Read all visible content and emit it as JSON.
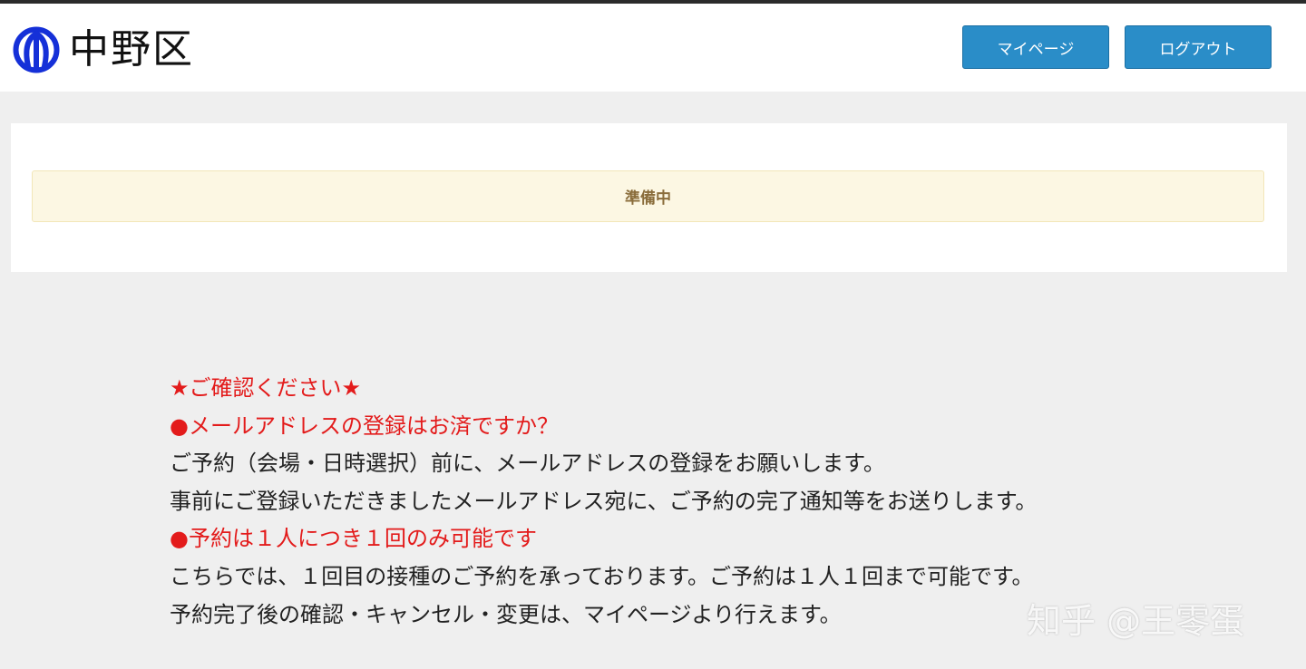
{
  "header": {
    "logo_text": "中野区",
    "buttons": {
      "mypage": "マイページ",
      "logout": "ログアウト"
    }
  },
  "panel": {
    "notice_text": "準備中"
  },
  "info": {
    "lines": [
      "★ご確認ください★",
      "●メールアドレスの登録はお済ですか？",
      "ご予約（会場・日時選択）前に、メールアドレスの登録をお願いします。",
      "事前にご登録いただきましたメールアドレス宛に、ご予約の完了通知等をお送りします。",
      "●予約は１人につき１回のみ可能です",
      "こちらでは、１回目の接種のご予約を承っております。ご予約は１人１回まで可能です。",
      "予約完了後の確認・キャンセル・変更は、マイページより行えます。"
    ]
  },
  "watermark": "知乎 @王零蛋",
  "colors": {
    "button_bg": "#2a8dc8",
    "alert_red": "#e31b1b",
    "notice_bg": "#fcf7e3",
    "notice_text": "#8a6d3b",
    "logo_blue": "#1530d8"
  },
  "icons": {
    "logo_mark": "nakano-ward-emblem"
  }
}
